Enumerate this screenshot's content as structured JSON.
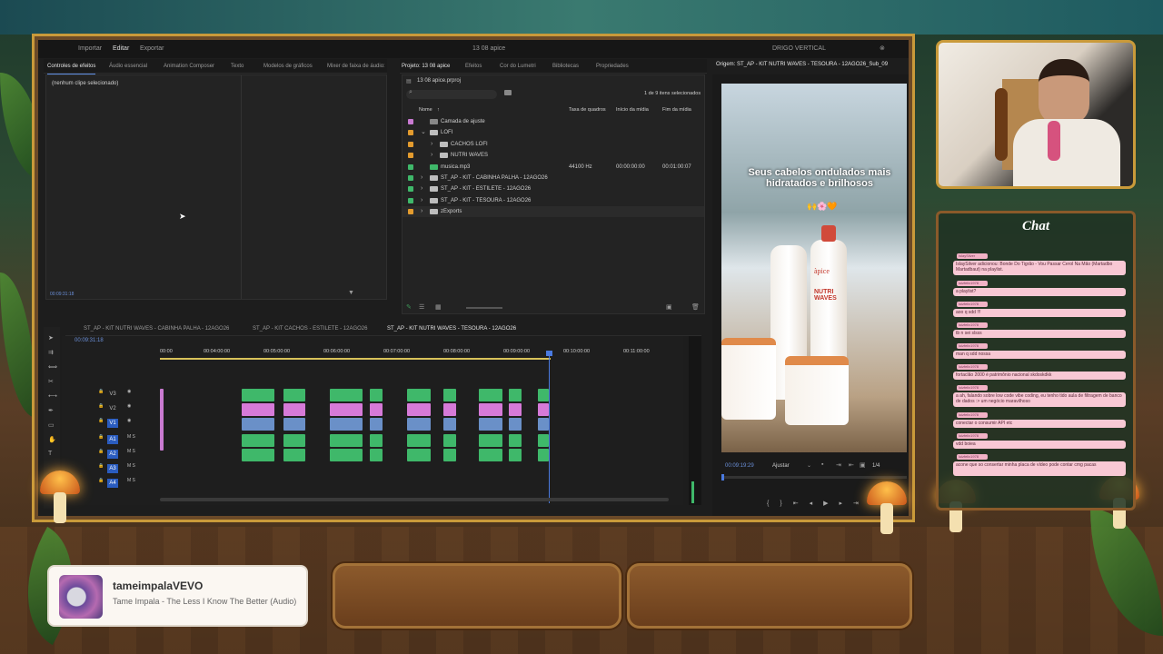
{
  "premiere": {
    "menu": {
      "items": [
        "Importar",
        "Editar",
        "Exportar"
      ],
      "title": "13 08 apice",
      "workspace": "DRIGO VERTICAL"
    },
    "left_tabs": [
      "Controles de efeitos",
      "Áudio essencial",
      "Animation Composer",
      "Texto",
      "Modelos de gráficos",
      "Mixer de faixa de áudio: ST_AP..."
    ],
    "no_clip": "(nenhum clipe selecionado)",
    "left_timecode": "00:09:31:18",
    "project": {
      "tabs": [
        "Projeto: 13 08 apice",
        "Efeitos",
        "Cor do Lumetri",
        "Bibliotecas",
        "Propriedades"
      ],
      "file": "13 08 apice.prproj",
      "selection": "1 de 9 itens selecionados",
      "columns": [
        "Nome",
        "Taxa de quadros",
        "Início da mídia",
        "Fim da mídia"
      ],
      "items": [
        {
          "name": "Camada de ajuste",
          "color": "#c97ad1",
          "indent": 0,
          "type": "item",
          "rate": "",
          "start": "",
          "end": ""
        },
        {
          "name": "LOFI",
          "color": "#e39b2e",
          "indent": 0,
          "type": "folder-open",
          "rate": "",
          "start": "",
          "end": ""
        },
        {
          "name": "CACHOS LOFI",
          "color": "#e39b2e",
          "indent": 1,
          "type": "folder",
          "rate": "",
          "start": "",
          "end": ""
        },
        {
          "name": "NUTRI WAVES",
          "color": "#e39b2e",
          "indent": 1,
          "type": "folder",
          "rate": "",
          "start": "",
          "end": ""
        },
        {
          "name": "musica.mp3",
          "color": "#3fb86a",
          "indent": 0,
          "type": "audio",
          "rate": "44100 Hz",
          "start": "00:00:00:00",
          "end": "00:01:00:07"
        },
        {
          "name": "ST_AP - KIT - CABINHA PALHA - 12AGO26",
          "color": "#3fb86a",
          "indent": 0,
          "type": "folder",
          "rate": "",
          "start": "",
          "end": ""
        },
        {
          "name": "ST_AP - KIT - ESTILETE - 12AGO26",
          "color": "#3fb86a",
          "indent": 0,
          "type": "folder",
          "rate": "",
          "start": "",
          "end": ""
        },
        {
          "name": "ST_AP - KIT - TESOURA - 12AGO26",
          "color": "#3fb86a",
          "indent": 0,
          "type": "folder",
          "rate": "",
          "start": "",
          "end": ""
        },
        {
          "name": "zExports",
          "color": "#e39b2e",
          "indent": 0,
          "type": "folder",
          "rate": "",
          "start": "",
          "end": ""
        }
      ]
    },
    "source": {
      "title": "Origem: ST_AP - KIT NUTRI WAVES - TESOURA - 12AGO26_Sub_09",
      "caption": "Seus cabelos ondulados  mais hidratados e brilhosos",
      "emoji": "🙌🌸🧡",
      "brand": "àpice",
      "product": "NUTRI WAVES",
      "timecode": "00:09:19:29",
      "fit": "Ajustar",
      "fraction": "1/4"
    },
    "timeline": {
      "tabs": [
        "ST_AP - KIT NUTRI WAVES - CABINHA PALHA - 12AGO26",
        "ST_AP - KIT CACHOS - ESTILETE - 12AGO26",
        "ST_AP - KIT NUTRI WAVES - TESOURA - 12AGO26"
      ],
      "timecode": "00:09:31:18",
      "ruler": [
        "00:00",
        "00:04:00:00",
        "00:05:00:00",
        "00:06:00:00",
        "00:07:00:00",
        "00:08:00:00",
        "00:09:00:00",
        "00:10:00:00",
        "00:11:00:00"
      ],
      "tracks": [
        "V3",
        "V2",
        "V1",
        "A1",
        "A2",
        "A3",
        "A4"
      ]
    }
  },
  "chat": {
    "title": "Chat",
    "messages": [
      {
        "user": "IslaySilver",
        "text": "IslaySilver adicionou: Bonde Do Tigrão - Vou Passar Cerol Na Mão (Martadbo Martadbaut) na playlist."
      },
      {
        "user": "luizfelix1978",
        "text": "a playlist?"
      },
      {
        "user": "luizfelix1978",
        "text": "aoo q sdd !!!"
      },
      {
        "user": "luizfelix1978",
        "text": "tb n sei slsss"
      },
      {
        "user": "luizfelix1978",
        "text": "man q sdd nossa"
      },
      {
        "user": "luizfelix1978",
        "text": "fortaclão 2000 é patrimônio nacional skdoskdkk"
      },
      {
        "user": "luizfelix1978",
        "text": "a ah, falando sobre low code vibe coding, eu tenho tido aula de filtragem de banco de dados :> um negócio maravilhoso"
      },
      {
        "user": "luizfelix1978",
        "text": "conectar o consumir API etc"
      },
      {
        "user": "luizfelix1978",
        "text": "vdd boiea"
      },
      {
        "user": "luizfelix1978",
        "text": "acone que so consertar minha placa de vídeo pode contar cmg pacas"
      }
    ]
  },
  "music": {
    "artist": "tameimpalaVEVO",
    "song": "Tame Impala - The Less I Know The Better (Audio)"
  }
}
